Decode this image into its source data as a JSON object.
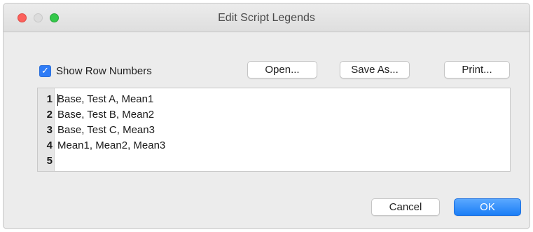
{
  "window": {
    "title": "Edit Script Legends"
  },
  "options": {
    "show_row_numbers_label": "Show Row Numbers",
    "show_row_numbers_checked": true,
    "checkmark_glyph": "✓"
  },
  "toolbar": {
    "open_label": "Open...",
    "save_as_label": "Save As...",
    "print_label": "Print..."
  },
  "editor": {
    "lines": [
      {
        "number": "1",
        "text": "Base, Test A, Mean1"
      },
      {
        "number": "2",
        "text": "Base, Test B, Mean2"
      },
      {
        "number": "3",
        "text": "Base, Test C, Mean3"
      },
      {
        "number": "4",
        "text": "Mean1, Mean2, Mean3"
      },
      {
        "number": "5",
        "text": ""
      }
    ]
  },
  "footer": {
    "cancel_label": "Cancel",
    "ok_label": "OK"
  },
  "colors": {
    "accent": "#2f7cf6",
    "close_button": "#fc605b",
    "zoom_button": "#34c84a",
    "window_background": "#ececec"
  },
  "icons": {
    "close": "close-window-icon",
    "minimize": "minimize-window-icon",
    "zoom": "zoom-window-icon",
    "checkbox": "checkmark-icon"
  }
}
